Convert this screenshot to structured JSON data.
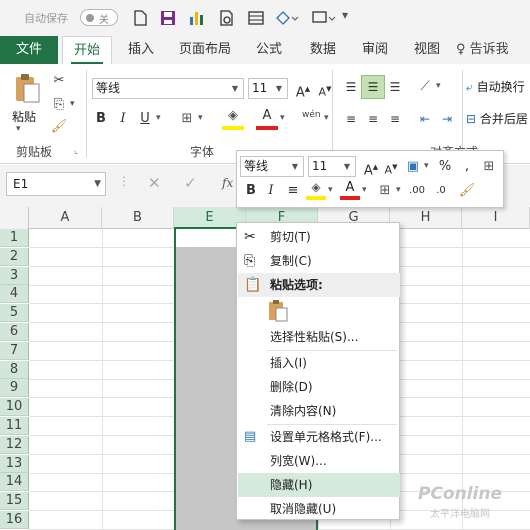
{
  "quick_access": {
    "autosave_label": "自动保存",
    "autosave_state": "关"
  },
  "tabs": [
    "文件",
    "开始",
    "插入",
    "页面布局",
    "公式",
    "数据",
    "审阅",
    "视图"
  ],
  "tell_me": "告诉我",
  "ribbon": {
    "paste_label": "粘贴",
    "clipboard_group": "剪贴板",
    "font_name": "等线",
    "font_size": "11",
    "font_group": "字体",
    "wen_label": "wén",
    "wrap_text": "自动换行",
    "merge_center": "合并后居",
    "align_group": "对齐方式"
  },
  "formula_bar": {
    "name_box": "E1",
    "fx": "fx"
  },
  "columns": [
    "A",
    "B",
    "E",
    "F",
    "G",
    "H",
    "I"
  ],
  "rows": [
    "1",
    "2",
    "3",
    "4",
    "5",
    "6",
    "7",
    "8",
    "9",
    "10",
    "11",
    "12",
    "13",
    "14",
    "15",
    "16"
  ],
  "mini_toolbar": {
    "font_name": "等线",
    "font_size": "11"
  },
  "context_menu": {
    "cut": "剪切(T)",
    "copy": "复制(C)",
    "paste_options": "粘贴选项:",
    "paste_special": "选择性粘贴(S)...",
    "insert": "插入(I)",
    "delete": "删除(D)",
    "clear": "清除内容(N)",
    "format_cells": "设置单元格格式(F)...",
    "column_width": "列宽(W)...",
    "hide": "隐藏(H)",
    "unhide": "取消隐藏(U)"
  },
  "watermark": {
    "brand": "PConline",
    "sub": "太平洋电脑网"
  },
  "colors": {
    "brand_green": "#217346",
    "selection_gray": "#c6c6c6",
    "highlight": "#d3eadc"
  }
}
